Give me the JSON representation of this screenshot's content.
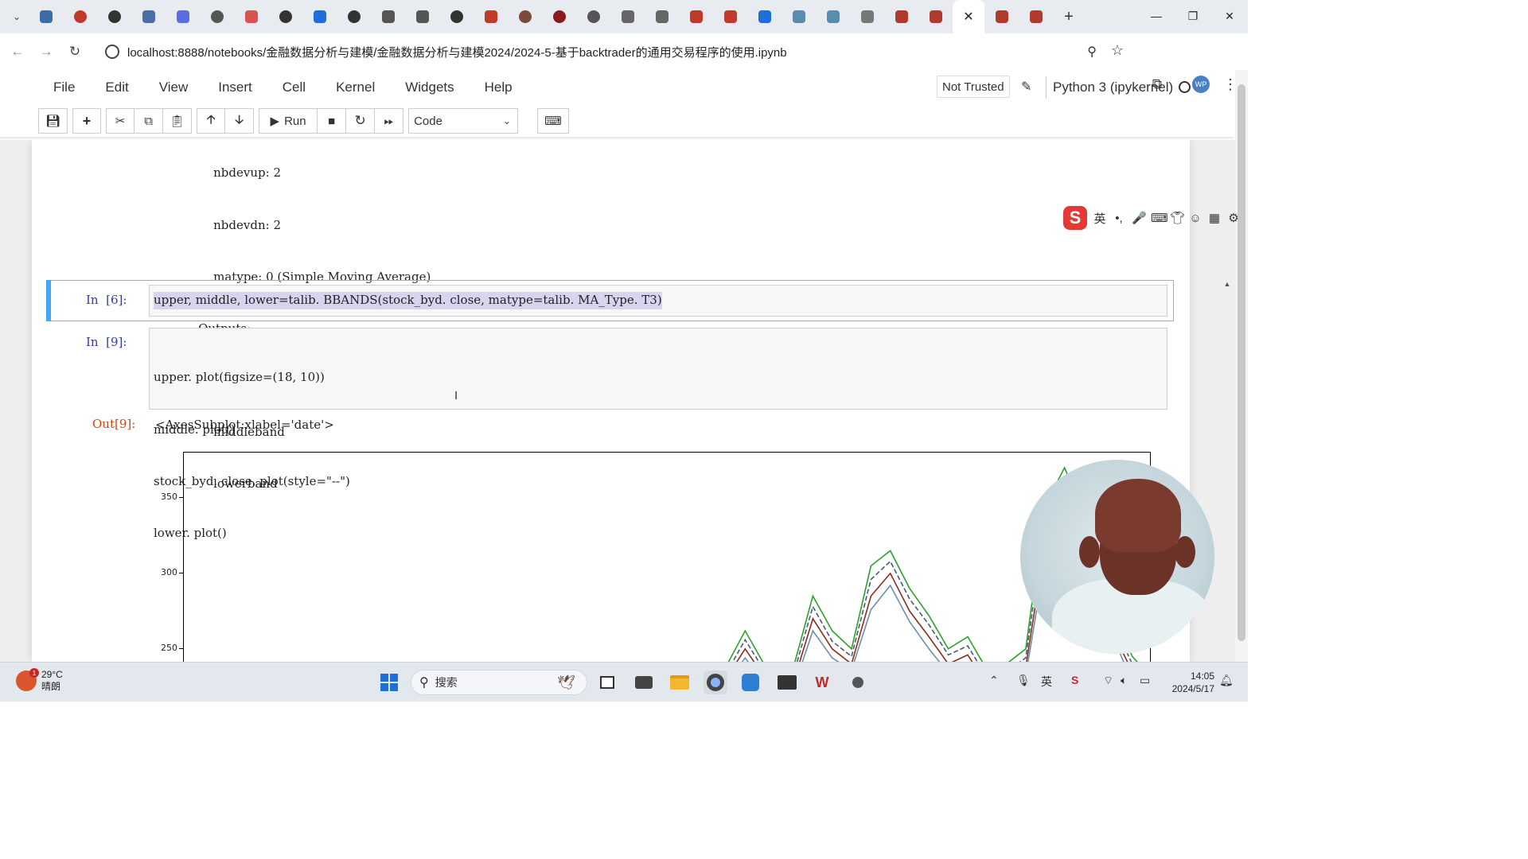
{
  "browser": {
    "tab_icons": [
      "bilibili-icon",
      "record-icon",
      "github-icon",
      "translate-icon",
      "download-icon",
      "globe-icon",
      "video-icon",
      "github-icon",
      "zhihu-icon",
      "github-icon",
      "cloud-icon",
      "cloud-icon",
      "github-icon",
      "c-icon",
      "chat-icon",
      "crown-icon",
      "globe-icon",
      "pen-icon",
      "robot-icon",
      "c-icon",
      "media-icon",
      "zhihu-icon",
      "bird-icon",
      "bird-icon",
      "loading-icon",
      "book-icon",
      "book-icon"
    ],
    "tab_icons_after": [
      "book-icon",
      "book-icon"
    ],
    "tab_colors": [
      "#3b6ea8",
      "#c0392b",
      "#333333",
      "#4a6fa5",
      "#5b6ee1",
      "#555555",
      "#d9534f",
      "#333333",
      "#1e6fd9",
      "#333333",
      "#555555",
      "#555555",
      "#333333",
      "#c0392b",
      "#7a4a3a",
      "#8b1a1a",
      "#555555",
      "#666666",
      "#666666",
      "#c0392b",
      "#c0392b",
      "#1e6fd9",
      "#5a8bb0",
      "#5a8bb0",
      "#777777",
      "#b03a2e",
      "#b03a2e"
    ],
    "active_tab_close": "✕",
    "new_tab": "+",
    "url": "localhost:8888/notebooks/金融数据分析与建模/金融数据分析与建模2024/2024-5-基于backtrader的通用交易程序的使用.ipynb",
    "avatar_text": "WP"
  },
  "jupyter": {
    "menus": [
      "File",
      "Edit",
      "View",
      "Insert",
      "Cell",
      "Kernel",
      "Widgets",
      "Help"
    ],
    "trusted": "Not Trusted",
    "kernel": "Python 3 (ipykernel)",
    "toolbar": {
      "run_label": "Run",
      "cell_type": "Code"
    }
  },
  "notebook": {
    "output_lines": [
      "        nbdevup: 2",
      "        nbdevdn: 2",
      "        matype: 0 (Simple Moving Average)",
      "    Outputs:",
      "        upperband",
      "        middleband",
      "        lowerband"
    ],
    "cell1": {
      "prompt": "In  [6]:",
      "code": "upper, middle, lower=talib. BBANDS(stock_byd. close, matype=talib. MA_Type. T3)"
    },
    "cell2": {
      "prompt": "In  [9]:",
      "code": [
        "upper. plot(figsize=(18, 10))",
        "middle. plot()",
        "stock_byd. close. plot(style=\"--\")",
        "lower. plot()"
      ],
      "out_prompt": "Out[9]:",
      "out_text": "<AxesSubplot:xlabel='date'>"
    }
  },
  "chart_data": {
    "type": "line",
    "xlabel": "date",
    "ylabel": "",
    "yticks": [
      250,
      300,
      350
    ],
    "ylim": [
      222,
      380
    ],
    "x": [
      0,
      10,
      20,
      30,
      40,
      50,
      55,
      58,
      61,
      63,
      65,
      67,
      69,
      71,
      73,
      75,
      77,
      79,
      81,
      83,
      85,
      87,
      89,
      91,
      93,
      95,
      97,
      98,
      99,
      100
    ],
    "series": [
      {
        "color": "#2ca02c",
        "values": [
          null,
          null,
          null,
          null,
          null,
          null,
          226,
          262,
          228,
          238,
          285,
          262,
          250,
          305,
          315,
          290,
          272,
          250,
          258,
          236,
          240,
          250,
          345,
          370,
          340,
          300,
          260,
          245,
          238,
          235
        ]
      },
      {
        "color": "#8c2d19",
        "values": [
          null,
          null,
          null,
          null,
          null,
          null,
          220,
          250,
          222,
          228,
          270,
          250,
          240,
          285,
          300,
          275,
          258,
          240,
          246,
          226,
          230,
          238,
          320,
          350,
          320,
          283,
          248,
          235,
          228,
          225
        ]
      },
      {
        "color": "#4a5a78",
        "values": [
          null,
          null,
          null,
          null,
          null,
          null,
          222,
          256,
          225,
          233,
          278,
          255,
          245,
          296,
          308,
          283,
          266,
          246,
          252,
          231,
          235,
          244,
          334,
          360,
          330,
          292,
          254,
          240,
          233,
          230
        ]
      },
      {
        "color": "#6b8fa8",
        "values": [
          null,
          null,
          null,
          null,
          null,
          null,
          218,
          244,
          219,
          224,
          262,
          244,
          236,
          276,
          292,
          268,
          250,
          234,
          240,
          222,
          225,
          232,
          310,
          340,
          312,
          275,
          243,
          230,
          224,
          220
        ]
      }
    ]
  },
  "ime": {
    "lang": "英",
    "punct": "•,",
    "mic": "🎤",
    "kbd": "⌨"
  },
  "taskbar": {
    "temperature": "29°C",
    "weather": "晴朗",
    "weather_badge": "1",
    "search_placeholder": "搜索",
    "ime_lang": "英",
    "time": "14:05",
    "date": "2024/5/17"
  }
}
